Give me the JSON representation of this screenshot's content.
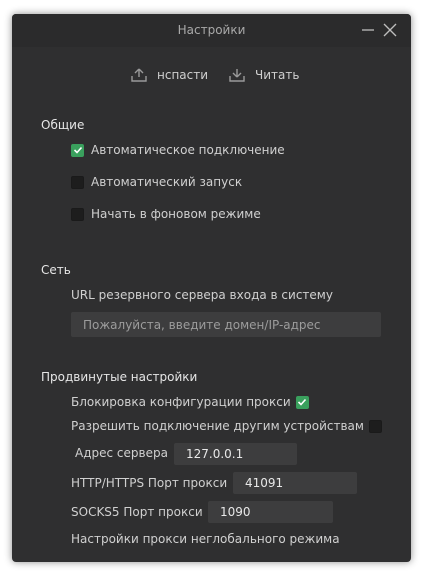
{
  "window": {
    "title": "Настройки"
  },
  "toolbar": {
    "save_label": "нспасти",
    "read_label": "Читать"
  },
  "general": {
    "title": "Общие",
    "auto_connect": {
      "label": "Автоматическое подключение",
      "checked": true
    },
    "auto_start": {
      "label": "Автоматический запуск",
      "checked": false
    },
    "background": {
      "label": "Начать в фоновом режиме",
      "checked": false
    }
  },
  "network": {
    "title": "Сеть",
    "backup_url_label": "URL резервного сервера входа в систему",
    "backup_url_placeholder": "Пожалуйста, введите домен/IP-адрес",
    "backup_url_value": ""
  },
  "advanced": {
    "title": "Продвинутые настройки",
    "lock_proxy": {
      "label": "Блокировка конфигурации прокси",
      "checked": true
    },
    "allow_other": {
      "label": "Разрешить подключение другим устройствам",
      "checked": false
    },
    "server_address": {
      "label": "Адрес сервера",
      "value": "127.0.0.1"
    },
    "http_port": {
      "label": "HTTP/HTTPS Порт прокси",
      "value": "41091"
    },
    "socks_port": {
      "label": "SOCKS5 Порт прокси",
      "value": "1090"
    },
    "non_global_label": "Настройки прокси неглобального режима"
  },
  "colors": {
    "window_bg": "#2f2f30",
    "checkbox_checked": "#3aa05d",
    "input_bg": "#3d3d3e"
  }
}
